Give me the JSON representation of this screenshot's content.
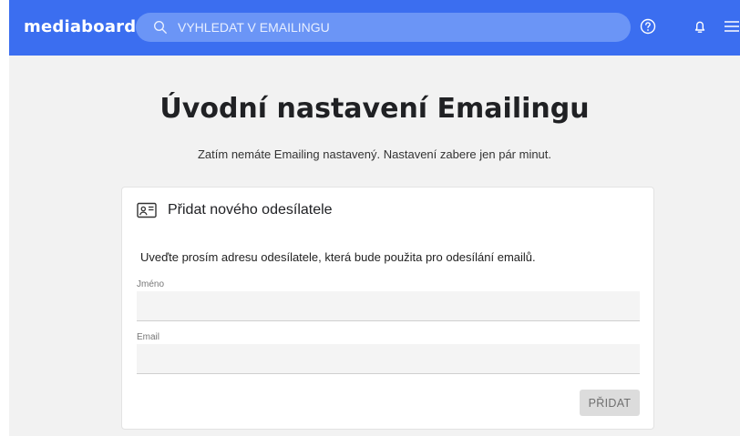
{
  "header": {
    "logo_text": "mediaboard",
    "search_placeholder": "VYHLEDAT V EMAILINGU",
    "icons": [
      "search-icon",
      "help-icon",
      "bell-icon",
      "menu-icon"
    ],
    "brand_color": "#3b6ef0"
  },
  "main": {
    "title": "Úvodní nastavení Emailingu",
    "subtitle": "Zatím nemáte Emailing nastavený. Nastavení zabere jen pár minut."
  },
  "card": {
    "icon": "contact-card-icon",
    "title": "Přidat nového odesílatele",
    "instructions": "Uveďte prosím adresu odesílatele, která bude použita pro odesílání emailů.",
    "fields": [
      {
        "label": "Jméno",
        "value": ""
      },
      {
        "label": "Email",
        "value": ""
      }
    ],
    "submit_label": "PŘIDAT"
  }
}
